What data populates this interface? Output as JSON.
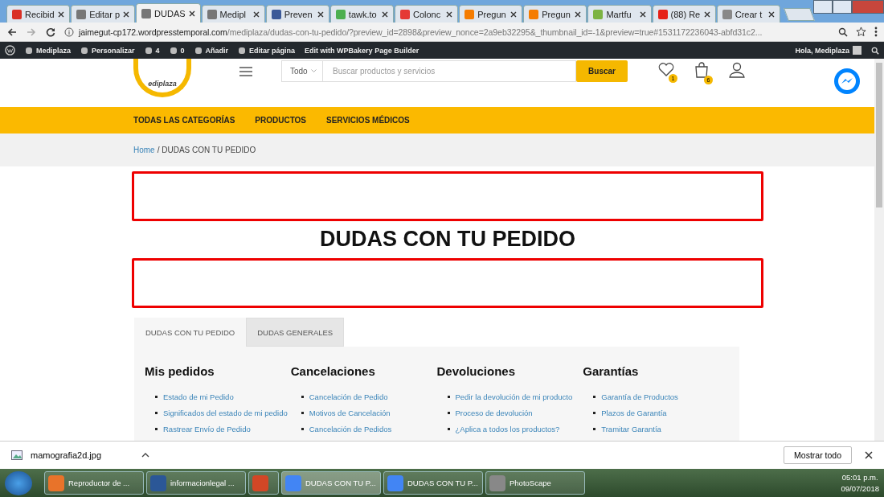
{
  "browser_tabs": [
    {
      "title": "Recibid",
      "selected": false,
      "color": "#d93025"
    },
    {
      "title": "Editar p",
      "selected": false,
      "color": "#777777"
    },
    {
      "title": "DUDAS",
      "selected": true,
      "color": "#777777"
    },
    {
      "title": "Medipl",
      "selected": false,
      "color": "#777777"
    },
    {
      "title": "Preven",
      "selected": false,
      "color": "#3b5998"
    },
    {
      "title": "tawk.to",
      "selected": false,
      "color": "#4caf50"
    },
    {
      "title": "Colonc",
      "selected": false,
      "color": "#e53935"
    },
    {
      "title": "Pregun",
      "selected": false,
      "color": "#f57c00"
    },
    {
      "title": "Pregun",
      "selected": false,
      "color": "#f57c00"
    },
    {
      "title": "Martfu",
      "selected": false,
      "color": "#7cb342"
    },
    {
      "title": "(88) Re",
      "selected": false,
      "color": "#e62117"
    },
    {
      "title": "Crear t",
      "selected": false,
      "color": "#888888"
    }
  ],
  "address": {
    "host": "jaimegut-cp172.wordpresstemporal.com",
    "path": "/mediplaza/dudas-con-tu-pedido/?preview_id=2898&preview_nonce=2a9eb32295&_thumbnail_id=-1&preview=true#1531172236043-abfd31c2..."
  },
  "admin_bar": {
    "items": [
      {
        "kind": "site",
        "label": "Mediplaza"
      },
      {
        "kind": "customize",
        "label": "Personalizar"
      },
      {
        "kind": "updates",
        "label": "4"
      },
      {
        "kind": "comments",
        "label": "0"
      },
      {
        "kind": "add",
        "label": "Añadir"
      },
      {
        "kind": "edit",
        "label": "Editar página"
      },
      {
        "kind": "builder",
        "label": "Edit with WPBakery Page Builder"
      }
    ],
    "greeting": "Hola, Mediplaza"
  },
  "header": {
    "logo_text": "ediplaza",
    "category": "Todo",
    "search_placeholder": "Buscar productos y servicios",
    "search_button": "Buscar",
    "wishlist_count": "1",
    "cart_count": "6"
  },
  "nav": [
    "TODAS LAS CATEGORÍAS",
    "PRODUCTOS",
    "SERVICIOS MÉDICOS"
  ],
  "breadcrumb": {
    "home": "Home",
    "current": "/ DUDAS CON TU PEDIDO"
  },
  "page_title": "DUDAS CON TU PEDIDO",
  "content_tabs": [
    {
      "label": "DUDAS CON TU PEDIDO",
      "selected": true
    },
    {
      "label": "DUDAS GENERALES",
      "selected": false
    }
  ],
  "columns": [
    {
      "heading": "Mis pedidos",
      "links": [
        "Estado de mi Pedido",
        "Significados del estado de mi pedido",
        "Rastrear Envío de Pedido"
      ]
    },
    {
      "heading": "Cancelaciones",
      "links": [
        "Cancelación de Pedido",
        "Motivos de Cancelación",
        "Cancelación de Pedidos"
      ]
    },
    {
      "heading": "Devoluciones",
      "links": [
        "Pedir la devolución de mi producto",
        "Proceso de devolución",
        "¿Aplica a todos los productos?"
      ]
    },
    {
      "heading": "Garantías",
      "links": [
        "Garantía de Productos",
        "Plazos de Garantía",
        "Tramitar Garantía"
      ]
    }
  ],
  "download_bar": {
    "file": "mamografia2d.jpg",
    "show_all": "Mostrar todo"
  },
  "taskbar": {
    "items": [
      {
        "kind": "media",
        "label": "Reproductor de ...",
        "selected": false
      },
      {
        "kind": "word",
        "label": "informacionlegal ...",
        "selected": false
      },
      {
        "kind": "ppt",
        "selected": false
      },
      {
        "kind": "chrome",
        "label": "DUDAS CON TU P...",
        "selected": true
      },
      {
        "kind": "chrome",
        "label": "DUDAS CON TU P...",
        "selected": false
      },
      {
        "kind": "photoscape",
        "label": "PhotoScape",
        "selected": false
      }
    ],
    "time": "05:01 p.m.",
    "date": "09/07/2018"
  }
}
